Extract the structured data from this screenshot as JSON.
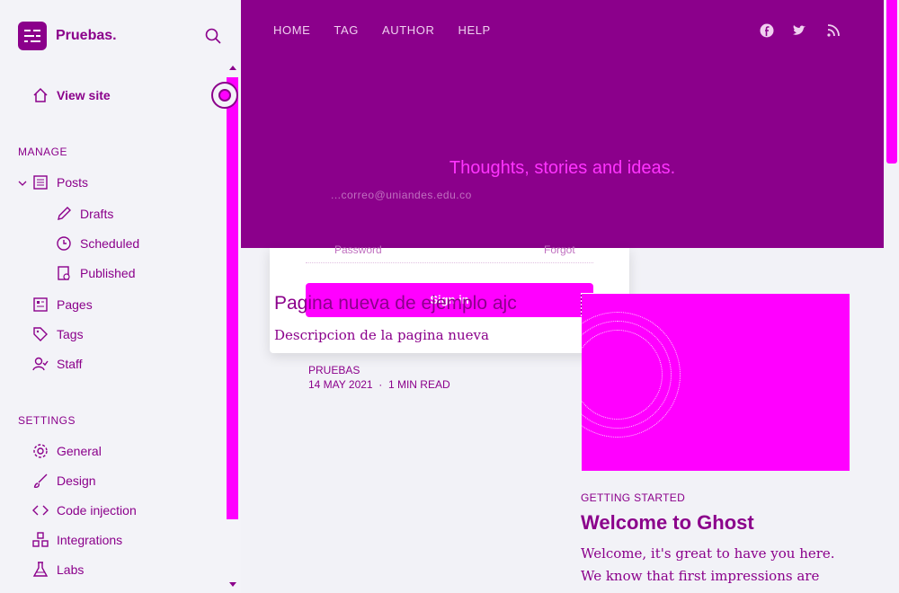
{
  "colors": {
    "accent": "#8b008b",
    "highlight": "#ff00ff",
    "background": "#f2f2f7"
  },
  "sidebar": {
    "brand": "Pruebas.",
    "view_site": "View site",
    "manage_title": "MANAGE",
    "settings_title": "SETTINGS",
    "manage_items": [
      {
        "label": "Posts",
        "icon": "posts-icon"
      },
      {
        "label": "Drafts",
        "icon": "pencil-icon"
      },
      {
        "label": "Scheduled",
        "icon": "clock-icon"
      },
      {
        "label": "Published",
        "icon": "published-icon"
      },
      {
        "label": "Pages",
        "icon": "pages-icon"
      },
      {
        "label": "Tags",
        "icon": "tag-icon"
      },
      {
        "label": "Staff",
        "icon": "staff-icon"
      }
    ],
    "settings_items": [
      {
        "label": "General",
        "icon": "gear-icon"
      },
      {
        "label": "Design",
        "icon": "brush-icon"
      },
      {
        "label": "Code injection",
        "icon": "code-icon"
      },
      {
        "label": "Integrations",
        "icon": "integrations-icon"
      },
      {
        "label": "Labs",
        "icon": "flask-icon"
      }
    ]
  },
  "header": {
    "nav": [
      "HOME",
      "TAG",
      "AUTHOR",
      "HELP"
    ],
    "tagline": "Thoughts, stories and ideas.",
    "email_ghost": "...correo@uniandes.edu.co"
  },
  "login_ghost": {
    "password": "Password",
    "forgot": "Forgot",
    "signin": "Sign in"
  },
  "page_card": {
    "title": "Pagina nueva de ejemplo ajc",
    "description": "Descripcion de la pagina nueva",
    "tag": "PRUEBAS",
    "date": "14 MAY 2021",
    "reading_time": "1 MIN READ"
  },
  "featured": {
    "label": "GETTING STARTED",
    "title": "Welcome to Ghost",
    "excerpt": "Welcome, it's great to have you here. We know that first impressions are important,"
  }
}
